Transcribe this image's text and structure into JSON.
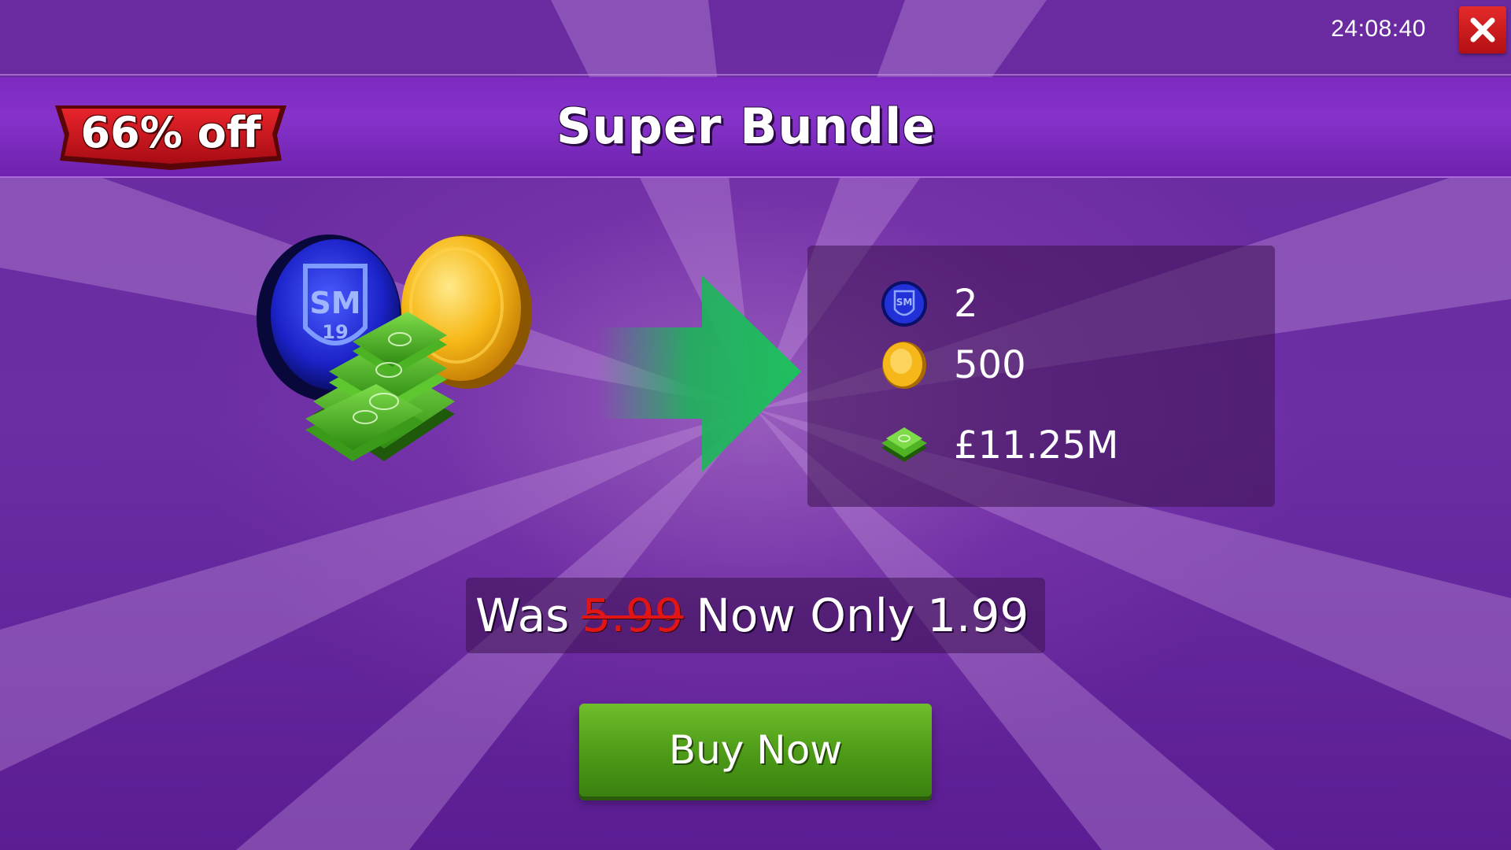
{
  "timer": "24:08:40",
  "header": {
    "title": "Super Bundle",
    "discount": "66% off"
  },
  "bundle": {
    "items": [
      {
        "icon": "sm-token-icon",
        "value": "2"
      },
      {
        "icon": "gold-coin-icon",
        "value": "500"
      },
      {
        "icon": "cash-stack-icon",
        "value": "£11.25M"
      }
    ]
  },
  "pricing": {
    "was_label": "Was",
    "old_price": "5.99",
    "now_label": "Now Only",
    "new_price": "1.99"
  },
  "buy_button": {
    "label": "Buy Now"
  },
  "colors": {
    "background": "#6b2ea3",
    "header_band": "#8632cb",
    "close_button": "#d21f22",
    "discount_banner": "#c8101a",
    "buy_button": "#4c9a17",
    "arrow": "#1db35a",
    "old_price": "#e11515"
  }
}
